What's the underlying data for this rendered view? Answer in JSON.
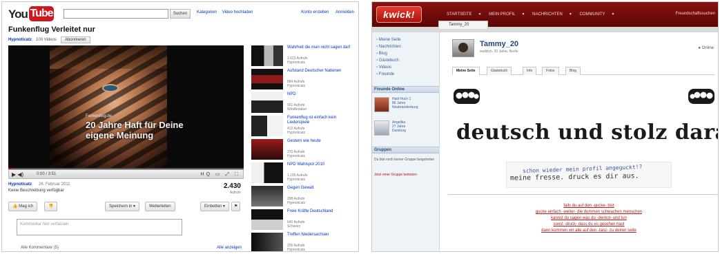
{
  "left": {
    "logo": {
      "you": "You",
      "tube": "Tube"
    },
    "search": {
      "button": "Suchen"
    },
    "top_links": [
      "Kategorien",
      "Video hochladen"
    ],
    "top_right_links": [
      "Konto erstellen",
      "Anmelden"
    ],
    "video_title": "Funkenflug Verleitet nur",
    "channel": {
      "name": "Hypnoticatz",
      "count": "100 Videos",
      "subscribe": "Abonnieren"
    },
    "player": {
      "overlay_small": "Funkenflug.de",
      "overlay_text": "20 Jahre Haft für Deine eigene Meinung",
      "time": "0:00 / 3:51",
      "progress": 0.02
    },
    "meta": {
      "channel": "Hypnoticatz",
      "date": "26. Februar 2011",
      "description": "Keine Beschreibung verfügbar",
      "views": "2.430",
      "views_label": "Aufrufe"
    },
    "actions": {
      "like": "Mag ich",
      "share": "Speichern in",
      "embed": "Weiterleiten",
      "flag": "Einbetten"
    },
    "comment_placeholder": "Kommentar hier verfassen",
    "comments_label": "Alle Kommentare (5)",
    "comments_link": "Alle anzeigen",
    "related": [
      {
        "title": "Wahrheit die man nicht sagen darf",
        "meta": "1.023 Aufrufe\nHypnoticatz"
      },
      {
        "title": "Aufstand Deutscher Nationen",
        "meta": "884 Aufrufe\nHypnoticatz"
      },
      {
        "title": "NPD",
        "meta": "551 Aufrufe\nWindbreaker"
      },
      {
        "title": "Funkenflug ist einfach kein Liederspiele",
        "meta": "412 Aufrufe\nHypnoticatz"
      },
      {
        "title": "Gestern wie heute",
        "meta": "370 Aufrufe\nHypnoticatz"
      },
      {
        "title": "NPD Wahlspot 2010",
        "meta": "1.155 Aufrufe\nHypnoticatz"
      },
      {
        "title": "Gegen Gewalt",
        "meta": "298 Aufrufe\nHypnoticatz"
      },
      {
        "title": "Freie Kräfte Deutschland",
        "meta": "640 Aufrufe\nSchwarz"
      },
      {
        "title": "Treffen Niedersachsen",
        "meta": "205 Aufrufe\nHypnoticatz"
      }
    ]
  },
  "right": {
    "logo": "kwick!",
    "nav": [
      "STARTSEITE",
      "MEIN PROFIL",
      "NACHRICHTEN",
      "COMMUNITY"
    ],
    "nav_right": "Freundschaftssuchen",
    "tab": "Tammy_20",
    "side_links": [
      "Meine Seite",
      "Nachrichten",
      "Blog",
      "Gästebuch",
      "Videos",
      "Freunde"
    ],
    "friends_head": "Freunde Online",
    "friends": [
      {
        "name": "Haiti Hoch 1\n86 Jahre\nNeubrandenburg"
      },
      {
        "name": "Angelika\n27 Jahre\nDuisburg"
      }
    ],
    "group_head": "Gruppen",
    "group_text": "Du bist noch keiner Gruppe beigetreten",
    "group_link": "Jetzt einer Gruppe beitreten",
    "user": {
      "name": "Tammy_20",
      "meta": "weiblich, 20 Jahre, Berlin",
      "status": "Online"
    },
    "profile_tabs": [
      "Meine Seite",
      "Gästebuch",
      "Info",
      "Fotos",
      "Blog"
    ],
    "banner": "deutsch und stolz darauf",
    "handwritten": {
      "line1": "schon wieder mein profil angeguckt!?",
      "line2": "meine fresse. druck es dir aus."
    },
    "footer_lines": [
      "falls du auf den -gucke- bist",
      "gucke einfach -weiter- die dummen schwachen menschen",
      "kannst du sagen was du -denkst- und tun",
      "sonst -druck- dass du es gesehen hast",
      "dann kommen wir alle auf den -tanz- zu deiner seite"
    ]
  }
}
